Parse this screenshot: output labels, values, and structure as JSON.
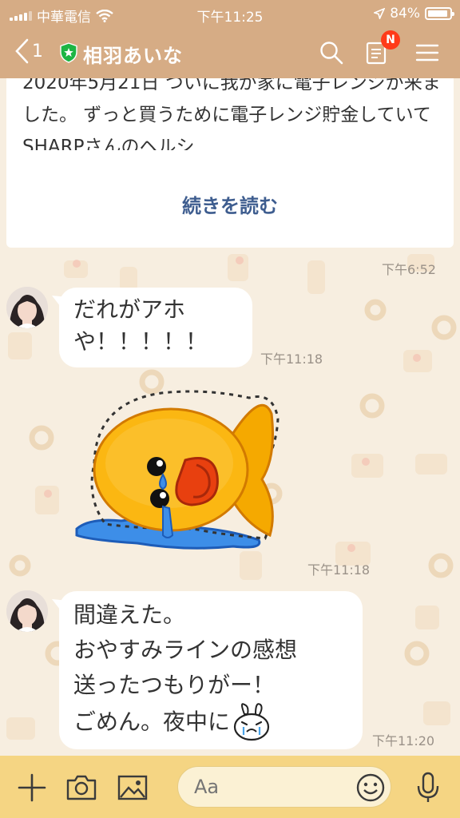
{
  "status_bar": {
    "carrier": "中華電信",
    "time": "下午11:25",
    "battery_text": "84%",
    "battery_level": 0.84
  },
  "header": {
    "back_count": "1",
    "contact_name": "相羽あいな",
    "notes_badge": "N",
    "colors": {
      "bar": "#d6ac85",
      "badge": "#ff3b19",
      "shield": "#1db544"
    }
  },
  "note": {
    "text": "2020年5月21日 ついに我が家に電子レンジが来ました。 ずっと買うために電子レンジ貯金していて SHARPさんのヘルシ…",
    "read_more": "続きを読む",
    "time": "下午6:52"
  },
  "messages": [
    {
      "text": "だれがアホや！！！！！",
      "time": "下午11:18"
    },
    {
      "type": "sticker",
      "sticker": "crying-fish-sticker",
      "time": "下午11:18"
    },
    {
      "lines": [
        "間違えた。",
        "おやすみラインの感想",
        "送ったつもりがー！",
        "ごめん。夜中に"
      ],
      "emoji": "crying-rabbit-emoji",
      "time": "下午11:20"
    }
  ],
  "input_bar": {
    "placeholder": "Aa",
    "colors": {
      "bar": "#f5d583",
      "field": "#fbf1d4"
    }
  }
}
